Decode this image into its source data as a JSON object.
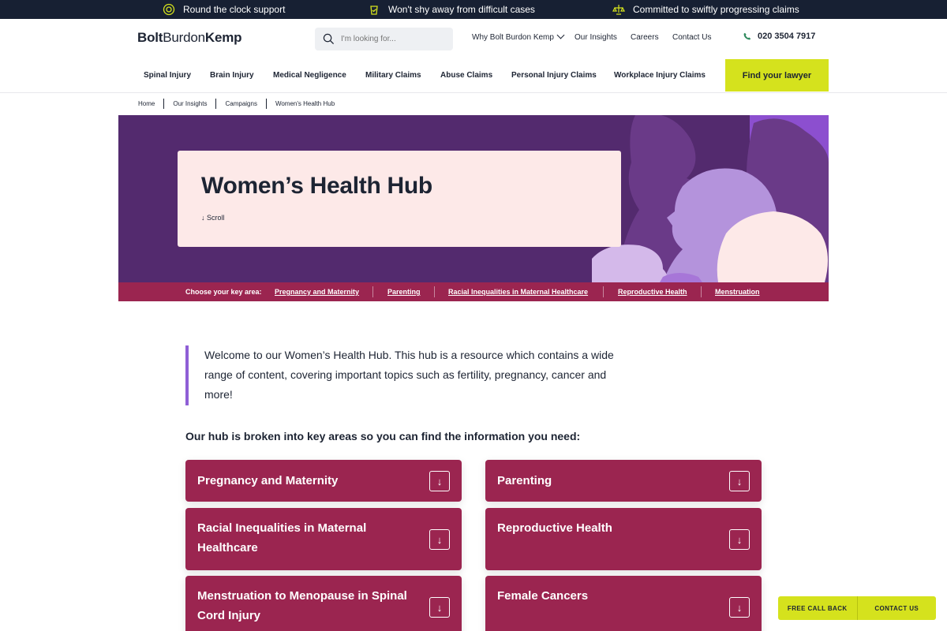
{
  "topbar": {
    "usps": [
      {
        "icon": "headset-icon",
        "text": "Round the clock support"
      },
      {
        "icon": "shield-check-icon",
        "text": "Won't shy away from difficult cases"
      },
      {
        "icon": "gavel-icon",
        "text": "Committed to swiftly progressing claims"
      }
    ]
  },
  "header": {
    "logo": {
      "part1": "Bolt",
      "part2": "Burdon",
      "part3": "Kemp"
    },
    "search_placeholder": "I'm looking for...",
    "links": [
      "Why Bolt Burdon Kemp",
      "Our Insights",
      "Careers",
      "Contact Us"
    ],
    "phone": "020 3504 7917",
    "nav": [
      "Spinal Injury",
      "Brain Injury",
      "Medical Negligence",
      "Military Claims",
      "Abuse Claims",
      "Personal Injury Claims",
      "Workplace Injury Claims"
    ],
    "cta": "Find your lawyer"
  },
  "breadcrumb": [
    "Home",
    "Our Insights",
    "Campaigns",
    "Women's Health Hub"
  ],
  "hero": {
    "title": "Women’s Health Hub",
    "scroll": "↓ Scroll"
  },
  "keybar": {
    "label": "Choose your key area:",
    "links": [
      "Pregnancy and Maternity",
      "Parenting",
      "Racial Inequalities in Maternal Healthcare",
      "Reproductive Health",
      "Menstruation"
    ]
  },
  "intro": "Welcome to our Women’s Health Hub. This hub is a resource which contains a wide range of content, covering important topics such as fertility, pregnancy, cancer and more!",
  "subhead": "Our hub is broken into key areas so you can find the information you need:",
  "tiles": [
    {
      "title": "Pregnancy and Maternity",
      "icon": "↓"
    },
    {
      "title": "Parenting",
      "icon": "↓"
    },
    {
      "title": "Racial Inequalities in Maternal Healthcare",
      "icon": "↓"
    },
    {
      "title": "Reproductive Health",
      "icon": "↓"
    },
    {
      "title": "Menstruation to Menopause in Spinal Cord Injury",
      "icon": "↓"
    },
    {
      "title": "Female Cancers",
      "icon": "↓"
    }
  ],
  "float_buttons": [
    "FREE CALL BACK",
    "CONTACT US"
  ],
  "colors": {
    "navy": "#172033",
    "plum": "#532a6e",
    "berry": "#9b2550",
    "lime": "#d5e21d",
    "blush": "#fde9e8",
    "lavender": "#8f5fd6"
  }
}
